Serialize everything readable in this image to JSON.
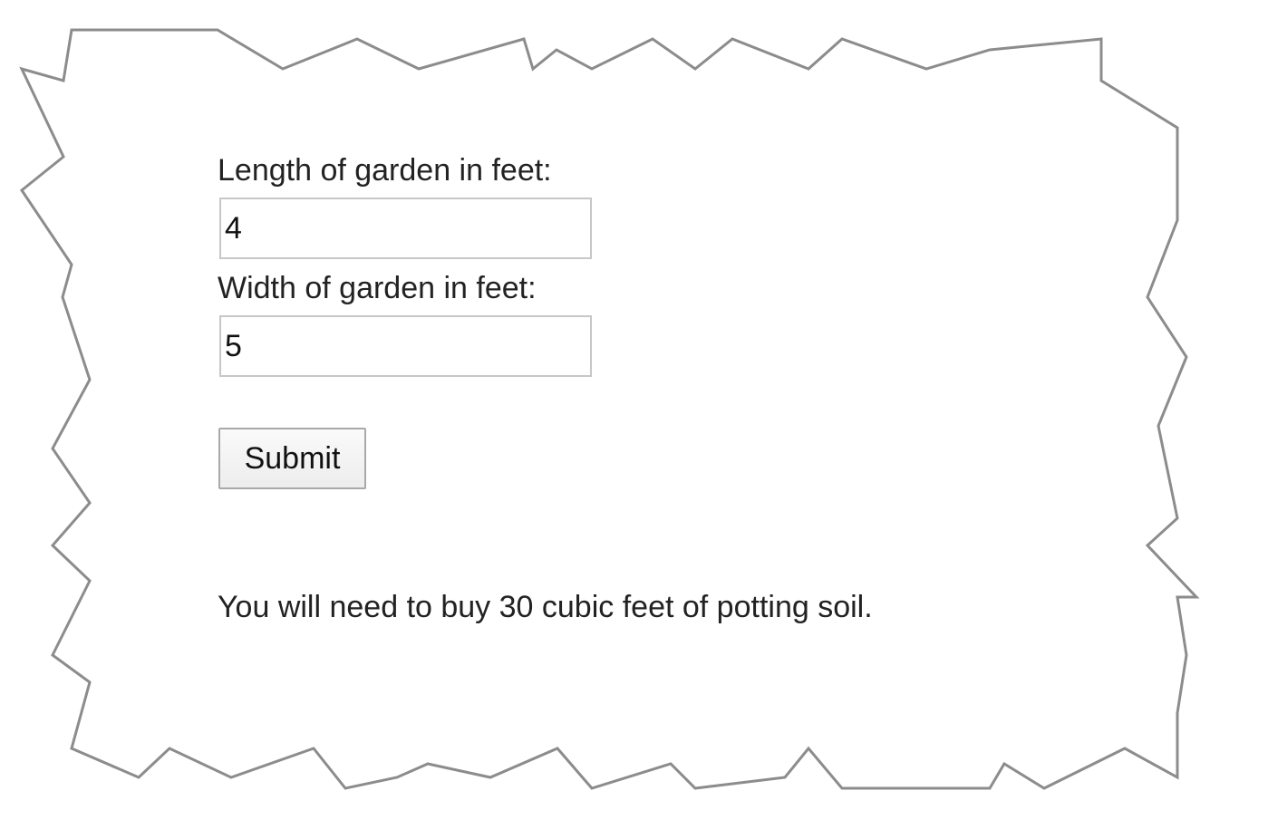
{
  "form": {
    "length_label": "Length of garden in feet:",
    "length_value": "4",
    "width_label": "Width of garden in feet:",
    "width_value": "5",
    "submit_label": "Submit"
  },
  "result": {
    "message": "You will need to buy 30 cubic feet of potting soil."
  },
  "colors": {
    "frame_stroke": "#8c8c8c",
    "text": "#222222",
    "input_border": "#c7c7c7"
  }
}
